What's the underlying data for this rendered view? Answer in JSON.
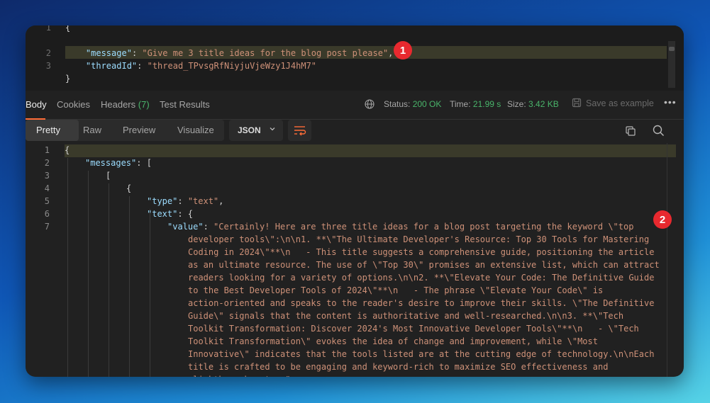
{
  "request_body": {
    "lines": [
      {
        "num": "1",
        "parts": [
          {
            "t": "{",
            "c": "punc"
          }
        ]
      },
      {
        "num": "2",
        "parts": [
          {
            "t": "    ",
            "c": "punc"
          },
          {
            "t": "\"message\"",
            "c": "key"
          },
          {
            "t": ": ",
            "c": "punc"
          },
          {
            "t": "\"Give me 3 title ideas for the blog post please\"",
            "c": "str"
          },
          {
            "t": ",",
            "c": "punc"
          }
        ]
      },
      {
        "num": "3",
        "parts": [
          {
            "t": "    ",
            "c": "punc"
          },
          {
            "t": "\"threadId\"",
            "c": "key"
          },
          {
            "t": ": ",
            "c": "punc"
          },
          {
            "t": "\"thread_TPvsgRfNiyjuVjeWzy1J4hM7\"",
            "c": "str"
          }
        ]
      },
      {
        "num": "}",
        "parts": [
          {
            "t": "}",
            "c": "punc"
          }
        ]
      }
    ]
  },
  "annotations": {
    "badge_1": "1",
    "badge_2": "2"
  },
  "response_tabs": {
    "body": "Body",
    "cookies": "Cookies",
    "headers": "Headers",
    "headers_count": "(7)",
    "test_results": "Test Results"
  },
  "status_info": {
    "status_label": "Status:",
    "status_value": "200 OK",
    "time_label": "Time:",
    "time_value": "21.99 s",
    "size_label": "Size:",
    "size_value": "3.42 KB",
    "save_example": "Save as example",
    "more": "•••"
  },
  "view_modes": [
    "Pretty",
    "Raw",
    "Preview",
    "Visualize"
  ],
  "format": "JSON",
  "response_body": {
    "lines": [
      {
        "num": "1",
        "indent": 0,
        "parts": [
          {
            "t": "{",
            "c": "punc"
          }
        ]
      },
      {
        "num": "2",
        "indent": 1,
        "parts": [
          {
            "t": "\"messages\"",
            "c": "key"
          },
          {
            "t": ": [",
            "c": "punc"
          }
        ]
      },
      {
        "num": "3",
        "indent": 2,
        "parts": [
          {
            "t": "[",
            "c": "punc"
          }
        ]
      },
      {
        "num": "4",
        "indent": 3,
        "parts": [
          {
            "t": "{",
            "c": "punc"
          }
        ]
      },
      {
        "num": "5",
        "indent": 4,
        "parts": [
          {
            "t": "\"type\"",
            "c": "key"
          },
          {
            "t": ": ",
            "c": "punc"
          },
          {
            "t": "\"text\"",
            "c": "str"
          },
          {
            "t": ",",
            "c": "punc"
          }
        ]
      },
      {
        "num": "6",
        "indent": 4,
        "parts": [
          {
            "t": "\"text\"",
            "c": "key"
          },
          {
            "t": ": {",
            "c": "punc"
          }
        ]
      },
      {
        "num": "7",
        "indent": 5,
        "parts": [
          {
            "t": "\"value\"",
            "c": "key"
          },
          {
            "t": ": ",
            "c": "punc"
          },
          {
            "t": "\"Certainly! Here are three title ideas for a blog post targeting the keyword \\\"top",
            "c": "str"
          }
        ]
      },
      {
        "num": "",
        "indent": 6,
        "parts": [
          {
            "t": "developer tools\\\":\\n\\n1. **\\\"The Ultimate Developer's Resource: Top 30 Tools for Mastering",
            "c": "str"
          }
        ]
      },
      {
        "num": "",
        "indent": 6,
        "parts": [
          {
            "t": "Coding in 2024\\\"**\\n   - This title suggests a comprehensive guide, positioning the article",
            "c": "str"
          }
        ]
      },
      {
        "num": "",
        "indent": 6,
        "parts": [
          {
            "t": "as an ultimate resource. The use of \\\"Top 30\\\" promises an extensive list, which can attract",
            "c": "str"
          }
        ]
      },
      {
        "num": "",
        "indent": 6,
        "parts": [
          {
            "t": "readers looking for a variety of options.\\n\\n2. **\\\"Elevate Your Code: The Definitive Guide",
            "c": "str"
          }
        ]
      },
      {
        "num": "",
        "indent": 6,
        "parts": [
          {
            "t": "to the Best Developer Tools of 2024\\\"**\\n   - The phrase \\\"Elevate Your Code\\\" is",
            "c": "str"
          }
        ]
      },
      {
        "num": "",
        "indent": 6,
        "parts": [
          {
            "t": "action-oriented and speaks to the reader's desire to improve their skills. \\\"The Definitive",
            "c": "str"
          }
        ]
      },
      {
        "num": "",
        "indent": 6,
        "parts": [
          {
            "t": "Guide\\\" signals that the content is authoritative and well-researched.\\n\\n3. **\\\"Tech",
            "c": "str"
          }
        ]
      },
      {
        "num": "",
        "indent": 6,
        "parts": [
          {
            "t": "Toolkit Transformation: Discover 2024's Most Innovative Developer Tools\\\"**\\n   - \\\"Tech",
            "c": "str"
          }
        ]
      },
      {
        "num": "",
        "indent": 6,
        "parts": [
          {
            "t": "Toolkit Transformation\\\" evokes the idea of change and improvement, while \\\"Most",
            "c": "str"
          }
        ]
      },
      {
        "num": "",
        "indent": 6,
        "parts": [
          {
            "t": "Innovative\\\" indicates that the tools listed are at the cutting edge of technology.\\n\\nEach",
            "c": "str"
          }
        ]
      },
      {
        "num": "",
        "indent": 6,
        "parts": [
          {
            "t": "title is crafted to be engaging and keyword-rich to maximize SEO effectiveness and",
            "c": "str"
          }
        ]
      },
      {
        "num": "",
        "indent": 6,
        "parts": [
          {
            "t": "clickthrough rates.\"",
            "c": "str"
          }
        ]
      }
    ]
  },
  "colors": {
    "accent": "#ff6c37",
    "status_ok": "#49b46a",
    "json_key": "#9cdcfe",
    "json_string": "#ce9178",
    "badge": "#e8292f"
  },
  "icons": [
    "globe-icon",
    "save-icon",
    "more-icon",
    "chevron-down-icon",
    "wrap-lines-icon",
    "copy-icon",
    "search-icon"
  ]
}
